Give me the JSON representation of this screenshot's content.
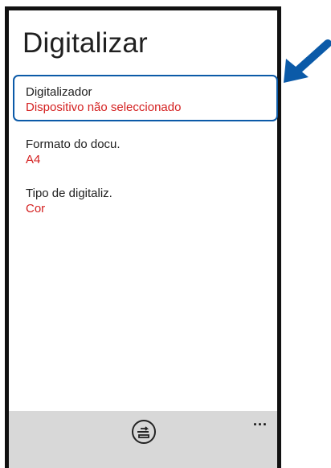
{
  "page": {
    "title": "Digitalizar"
  },
  "settings": {
    "scanner": {
      "label": "Digitalizador",
      "value": "Dispositivo não seleccionado"
    },
    "format": {
      "label": "Formato do docu.",
      "value": "A4"
    },
    "scan_type": {
      "label": "Tipo de digitaliz.",
      "value": "Cor"
    }
  },
  "appbar": {
    "scan_icon": "scan-icon",
    "more_label": "..."
  },
  "colors": {
    "value_text": "#d42020",
    "highlight": "#0b5aa8",
    "appbar_background": "#d8d8d8"
  }
}
